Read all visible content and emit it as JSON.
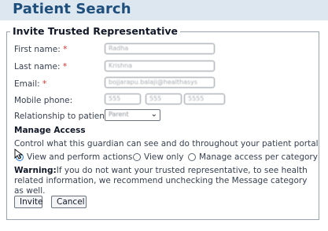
{
  "header": {
    "title": "Patient Search"
  },
  "panel": {
    "legend": "Invite Trusted Representative"
  },
  "form": {
    "first_name": {
      "label": "First name:",
      "required_mark": "*",
      "value": "Radha"
    },
    "last_name": {
      "label": "Last name:",
      "required_mark": "*",
      "value": "Krishna"
    },
    "email": {
      "label": "Email:",
      "required_mark": "*",
      "value": "bojjarapu.balaji@healthasys"
    },
    "mobile": {
      "label": "Mobile phone:",
      "area": "555",
      "prefix": "555",
      "line": "5555"
    },
    "relationship": {
      "label": "Relationship to patient:",
      "selected": "Parent"
    }
  },
  "access": {
    "title": "Manage Access",
    "description": "Control what this guardian can see and do throughout your patient portal",
    "options": [
      {
        "label": "View and perform actions",
        "checked": true
      },
      {
        "label": "View only",
        "checked": false
      },
      {
        "label": "Manage access per category",
        "checked": false
      }
    ],
    "warning_label": "Warning:",
    "warning_text": "If you do not want your trusted representative, to see health related information, we recommend unchecking the Message category as well."
  },
  "actions": {
    "invite": "Invite",
    "cancel": "Cancel"
  },
  "colors": {
    "title": "#1f4f7c",
    "required": "#d32f2f",
    "radio_accent": "#1a73e8"
  }
}
